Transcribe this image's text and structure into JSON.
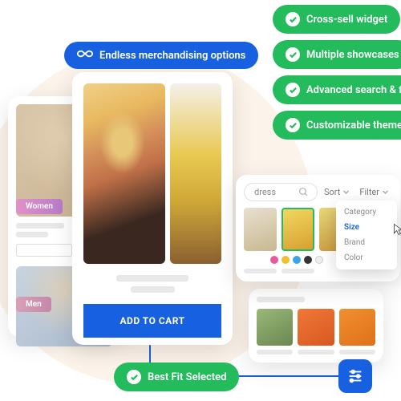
{
  "pills": {
    "merch": "Endless merchandising options",
    "cross_sell": "Cross-sell widget",
    "showcases": "Multiple showcases",
    "search": "Advanced search & filter",
    "theme": "Customizable theme options",
    "best_fit": "Best Fit Selected"
  },
  "back_card": {
    "tag1": "Women",
    "tag2": "Men"
  },
  "main": {
    "add_to_cart": "ADD TO CART"
  },
  "filter": {
    "query": "dress",
    "sort": "Sort",
    "filter": "Filter",
    "options": [
      "Category",
      "Size",
      "Brand",
      "Color"
    ],
    "selected": "Size",
    "swatches": [
      "#e85a9a",
      "#f0c030",
      "#3aa3e8",
      "#333",
      "#eee"
    ]
  },
  "colors": {
    "blue": "#1761e0",
    "green": "#24bb5d"
  }
}
